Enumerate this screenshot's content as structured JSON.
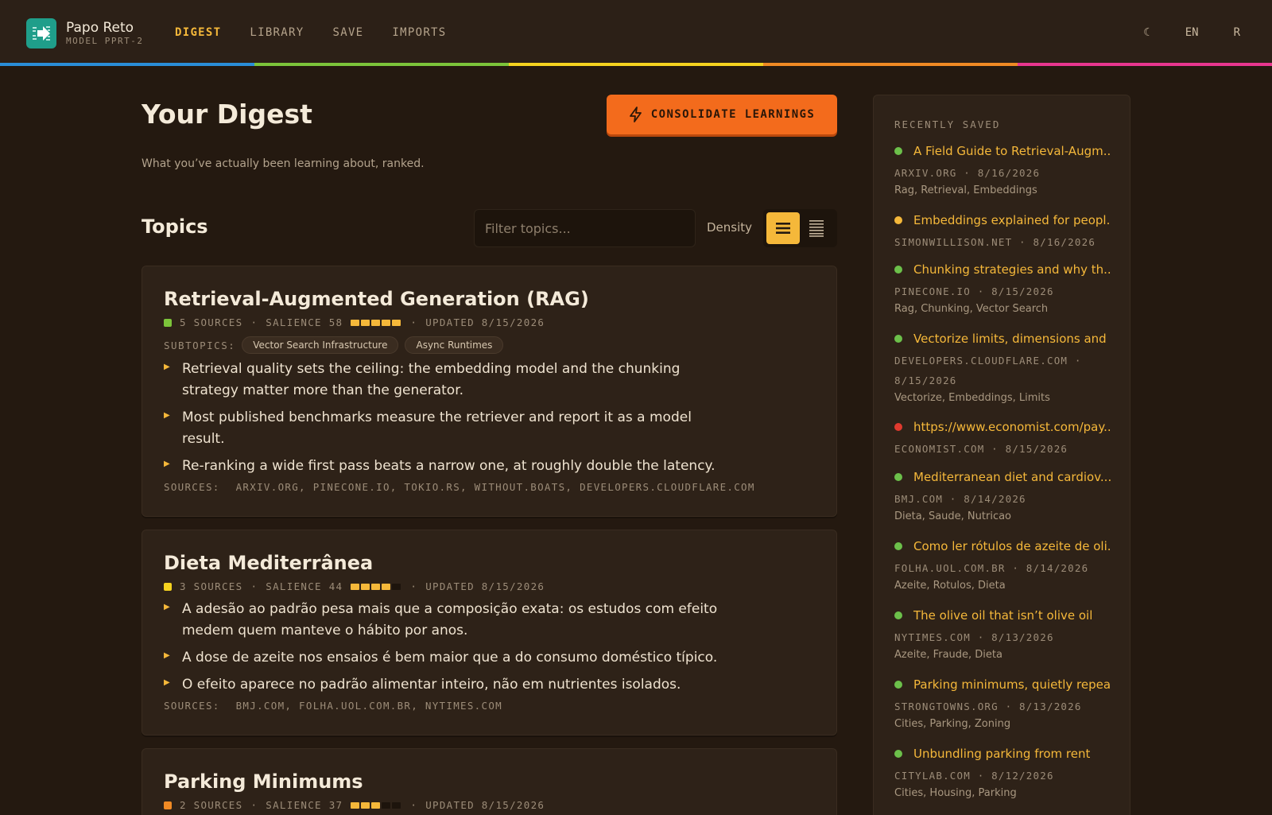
{
  "app": {
    "name": "Papo Reto",
    "model": "MODEL PPRT-2",
    "nav": [
      "DIGEST",
      "LIBRARY",
      "SAVE",
      "IMPORTS"
    ],
    "theme_toggle": "☾",
    "language": "EN",
    "user_initial": "R",
    "accent": "#f5b83a",
    "stripe_colors": [
      "#2a8ed8",
      "#7cc43a",
      "#f5d21f",
      "#f08a24",
      "#e8368f"
    ]
  },
  "digest": {
    "title": "Your Digest",
    "subtitle": "What you’ve actually been learning about, ranked.",
    "consolidate_label": "CONSOLIDATE LEARNINGS"
  },
  "topics_section": {
    "title": "Topics",
    "filter_placeholder": "Filter topics...",
    "density_label": "Density"
  },
  "topics": [
    {
      "title": "Retrieval-Augmented Generation (RAG)",
      "color": "#7cc43a",
      "sources_count": "5 SOURCES",
      "salience": "SALIENCE 58",
      "salience_level": 5,
      "updated": "UPDATED 8/15/2026",
      "subtopics_label": "SUBTOPICS:",
      "subtopics": [
        "Vector Search Infrastructure",
        "Async Runtimes"
      ],
      "bullets": [
        "Retrieval quality sets the ceiling: the embedding model and the chunking strategy matter more than the generator.",
        "Most published benchmarks measure the retriever and report it as a model result.",
        "Re-ranking a wide first pass beats a narrow one, at roughly double the latency."
      ],
      "sources_label": "SOURCES:",
      "sources": "ARXIV.ORG, PINECONE.IO, TOKIO.RS, WITHOUT.BOATS, DEVELOPERS.CLOUDFLARE.COM"
    },
    {
      "title": "Dieta Mediterrânea",
      "color": "#f5d21f",
      "sources_count": "3 SOURCES",
      "salience": "SALIENCE 44",
      "salience_level": 4,
      "updated": "UPDATED 8/15/2026",
      "bullets": [
        "A adesão ao padrão pesa mais que a composição exata: os estudos com efeito medem quem manteve o hábito por anos.",
        "A dose de azeite nos ensaios é bem maior que a do consumo doméstico típico.",
        "O efeito aparece no padrão alimentar inteiro, não em nutrientes isolados."
      ],
      "sources_label": "SOURCES:",
      "sources": "BMJ.COM, FOLHA.UOL.COM.BR, NYTIMES.COM"
    },
    {
      "title": "Parking Minimums",
      "color": "#f08a24",
      "sources_count": "2 SOURCES",
      "salience": "SALIENCE 37",
      "salience_level": 3,
      "updated": "UPDATED 8/15/2026"
    }
  ],
  "sidebar": {
    "heading": "RECENTLY SAVED",
    "items": [
      {
        "title": "A Field Guide to Retrieval-Augm...",
        "status": "#6cc04a",
        "meta": "ARXIV.ORG · 8/16/2026",
        "tags": "Rag, Retrieval, Embeddings"
      },
      {
        "title": "Embeddings explained for peopl...",
        "status": "#f5b83a",
        "meta": "SIMONWILLISON.NET · 8/16/2026",
        "tags": ""
      },
      {
        "title": "Chunking strategies and why th...",
        "status": "#6cc04a",
        "meta": "PINECONE.IO · 8/15/2026",
        "tags": "Rag, Chunking, Vector Search"
      },
      {
        "title": "Vectorize limits, dimensions and ...",
        "status": "#6cc04a",
        "meta": "DEVELOPERS.CLOUDFLARE.COM · 8/15/2026",
        "tags": "Vectorize, Embeddings, Limits"
      },
      {
        "title": "https://www.economist.com/pay...",
        "status": "#e03a2e",
        "meta": "ECONOMIST.COM · 8/15/2026",
        "tags": ""
      },
      {
        "title": "Mediterranean diet and cardiov...",
        "status": "#6cc04a",
        "meta": "BMJ.COM · 8/14/2026",
        "tags": "Dieta, Saude, Nutricao"
      },
      {
        "title": "Como ler rótulos de azeite de oli...",
        "status": "#6cc04a",
        "meta": "FOLHA.UOL.COM.BR · 8/14/2026",
        "tags": "Azeite, Rotulos, Dieta"
      },
      {
        "title": "The olive oil that isn’t olive oil",
        "status": "#6cc04a",
        "meta": "NYTIMES.COM · 8/13/2026",
        "tags": "Azeite, Fraude, Dieta"
      },
      {
        "title": "Parking minimums, quietly repea...",
        "status": "#6cc04a",
        "meta": "STRONGTOWNS.ORG · 8/13/2026",
        "tags": "Cities, Parking, Zoning"
      },
      {
        "title": "Unbundling parking from rent",
        "status": "#6cc04a",
        "meta": "CITYLAB.COM · 8/12/2026",
        "tags": "Cities, Housing, Parking"
      }
    ]
  }
}
